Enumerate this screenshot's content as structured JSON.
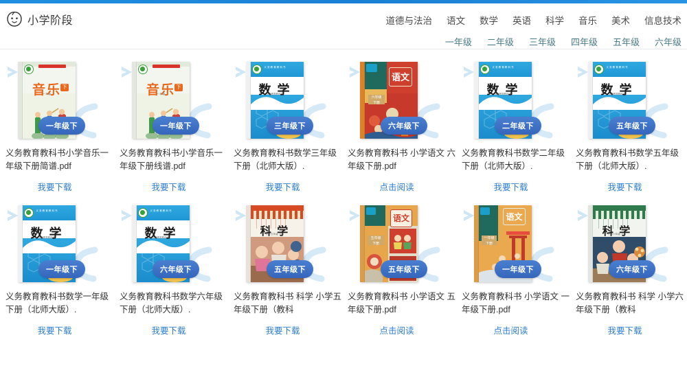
{
  "header": {
    "brand": "小学阶段",
    "logo_icon": "child-face-icon",
    "subjects": [
      {
        "label": "道德与法治"
      },
      {
        "label": "语文"
      },
      {
        "label": "数学"
      },
      {
        "label": "英语"
      },
      {
        "label": "科学"
      },
      {
        "label": "音乐"
      },
      {
        "label": "美术"
      },
      {
        "label": "信息技术"
      }
    ],
    "grades": [
      {
        "label": "一年级"
      },
      {
        "label": "二年级"
      },
      {
        "label": "三年级"
      },
      {
        "label": "四年级"
      },
      {
        "label": "五年级"
      },
      {
        "label": "六年级"
      }
    ]
  },
  "colors": {
    "accent_bar": "#1f8fe0",
    "link": "#2f7fd0",
    "badge": "#3566bb",
    "grade_nav": "#4b7b86",
    "deco": "#cfe6f5"
  },
  "books": [
    {
      "cover_subject": "音乐",
      "cover_style": "music-green",
      "badge": "一年级下",
      "title": "义务教育教科书小学音乐一年级下册简谱.pdf",
      "action": "我要下载"
    },
    {
      "cover_subject": "音乐",
      "cover_style": "music-green",
      "badge": "一年级下",
      "title": "义务教育教科书小学音乐一年级下册线谱.pdf",
      "action": "我要下载"
    },
    {
      "cover_subject": "数学",
      "cover_style": "math-blue",
      "badge": "三年级下",
      "title": "义务教育教科书数学三年级下册（北师大版）.",
      "action": "我要下载"
    },
    {
      "cover_subject": "语文",
      "cover_style": "chinese-orange",
      "badge": "六年级下",
      "title": "义务教育教科书 小学语文 六年级下册.pdf",
      "action": "点击阅读"
    },
    {
      "cover_subject": "数学",
      "cover_style": "math-blue",
      "badge": "二年级下",
      "title": "义务教育教科书数学二年级下册（北师大版）.",
      "action": "我要下载"
    },
    {
      "cover_subject": "数学",
      "cover_style": "math-blue",
      "badge": "五年级下",
      "title": "义务教育教科书数学五年级下册（北师大版）.",
      "action": "我要下载"
    },
    {
      "cover_subject": "数学",
      "cover_style": "math-blue",
      "badge": "一年级下",
      "title": "义务教育教科书数学一年级下册（北师大版）.",
      "action": "我要下载"
    },
    {
      "cover_subject": "数学",
      "cover_style": "math-blue",
      "badge": "六年级下",
      "title": "义务教育教科书数学六年级下册（北师大版）.",
      "action": "我要下载"
    },
    {
      "cover_subject": "科学",
      "cover_style": "science-orange",
      "badge": "五年级下",
      "title": "义务教育教科书 科学 小学五年级下册（教科",
      "action": "我要下载"
    },
    {
      "cover_subject": "语文",
      "cover_style": "chinese-orange2",
      "badge": "五年级下",
      "title": "义务教育教科书 小学语文 五年级下册.pdf",
      "action": "点击阅读"
    },
    {
      "cover_subject": "语文",
      "cover_style": "chinese-orange3",
      "badge": "一年级下",
      "title": "义务教育教科书 小学语文 一年级下册.pdf",
      "action": "点击阅读"
    },
    {
      "cover_subject": "科学",
      "cover_style": "science-green",
      "badge": "六年级下",
      "title": "义务教育教科书 科学 小学六年级下册（教科",
      "action": "我要下载"
    }
  ]
}
